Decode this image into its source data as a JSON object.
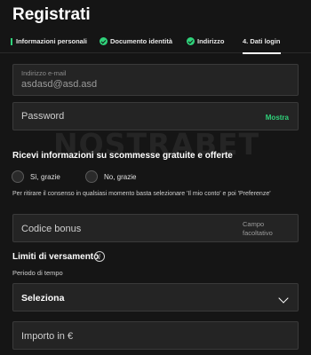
{
  "page": {
    "title": "Registrati"
  },
  "steps": [
    {
      "label": "Informazioni personali",
      "state": "done"
    },
    {
      "label": "Documento identità",
      "state": "done"
    },
    {
      "label": "Indirizzo",
      "state": "done"
    },
    {
      "label": "4.  Dati login",
      "state": "active"
    }
  ],
  "email": {
    "label": "Indirizzo e-mail",
    "value": "asdasd@asd.asd"
  },
  "password": {
    "placeholder": "Password",
    "show_label": "Mostra"
  },
  "marketing": {
    "title": "Ricevi informazioni su scommesse gratuite e offerte",
    "options": [
      "Sì, grazie",
      "No, grazie"
    ],
    "note": "Per ritirare il consenso in qualsiasi momento basta selezionare 'Il mio conto' e poi 'Preferenze'"
  },
  "bonus": {
    "placeholder": "Codice bonus",
    "optional_label": "Campo facoltativo"
  },
  "limits": {
    "title": "Limiti di versamento",
    "period_label": "Periodo di tempo",
    "select_value": "Seleziona",
    "amount_placeholder": "Importo in €"
  },
  "watermark": {
    "text": "NOSTRABET"
  },
  "colors": {
    "accent": "#2fd27a",
    "background": "#151515",
    "field": "#242424"
  }
}
